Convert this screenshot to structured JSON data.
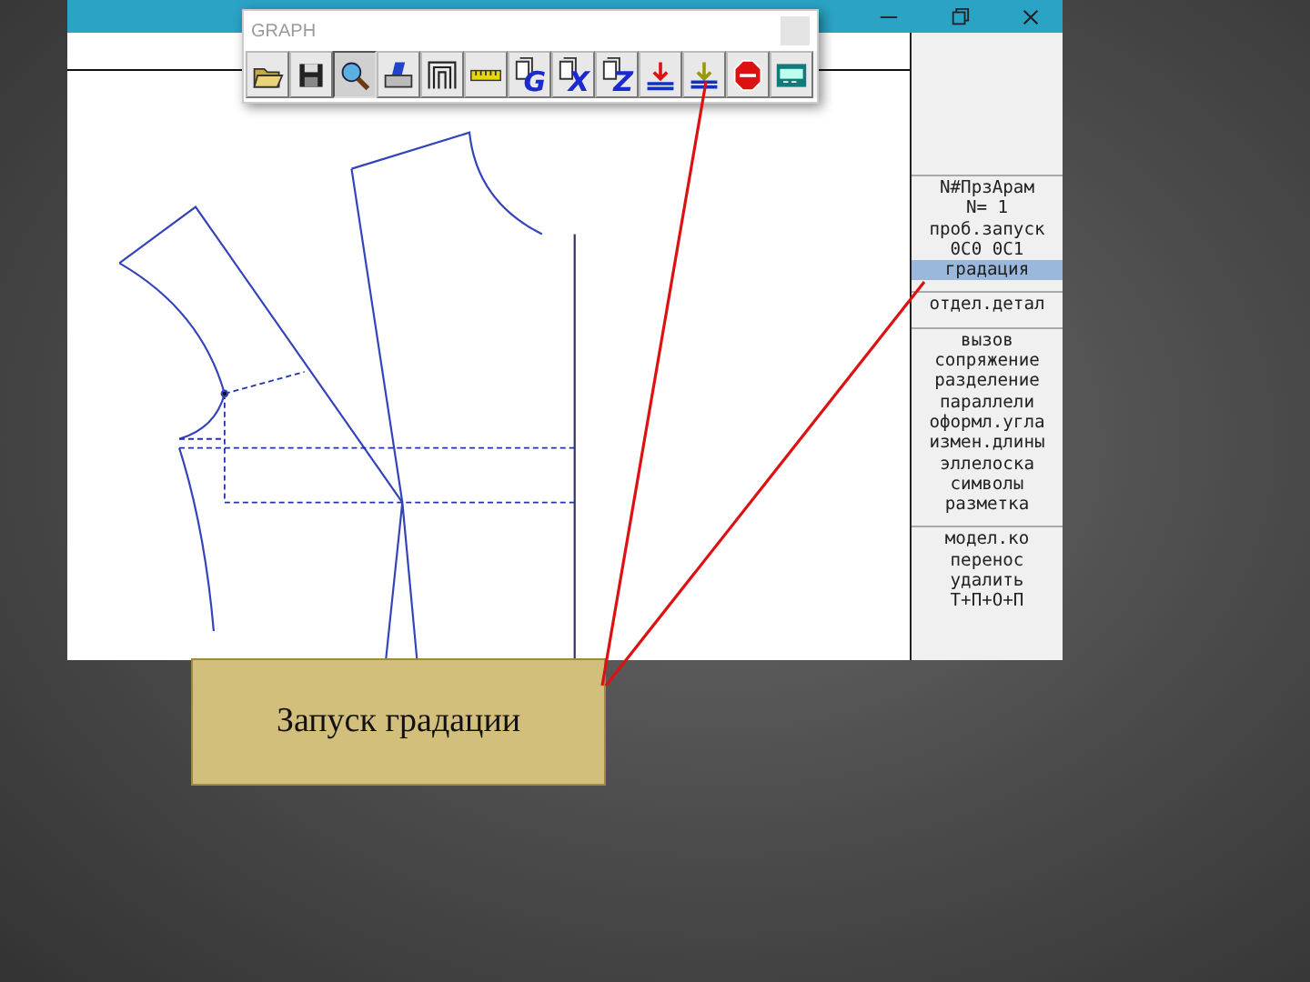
{
  "toolbar": {
    "title": "GRAPH",
    "buttons": [
      {
        "kind": "open",
        "pressed": false
      },
      {
        "kind": "save",
        "pressed": false
      },
      {
        "kind": "zoom",
        "pressed": true
      },
      {
        "kind": "print",
        "pressed": false
      },
      {
        "kind": "frame",
        "pressed": false
      },
      {
        "kind": "ruler",
        "pressed": false
      },
      {
        "kind": "doc",
        "letter": "G",
        "pressed": false
      },
      {
        "kind": "doc",
        "letter": "X",
        "pressed": false
      },
      {
        "kind": "doc",
        "letter": "Z",
        "pressed": false
      },
      {
        "kind": "drop",
        "pressed": false
      },
      {
        "kind": "drop2",
        "pressed": false
      },
      {
        "kind": "stop",
        "pressed": false
      },
      {
        "kind": "screen",
        "pressed": false
      }
    ]
  },
  "menu": {
    "groups": [
      {
        "items": [
          {
            "label": "N#ПрзАрам",
            "selected": false
          },
          {
            "label": "N=  1",
            "selected": false
          },
          {
            "label": "проб.запуск",
            "selected": false
          },
          {
            "label": "0С0 0С1",
            "selected": false
          },
          {
            "label": "градация",
            "selected": true
          }
        ]
      },
      {
        "items": [
          {
            "label": "отдел.детал",
            "selected": false
          }
        ]
      },
      {
        "items": [
          {
            "label": "вызов",
            "selected": false
          },
          {
            "label": "сопряжение",
            "selected": false
          },
          {
            "label": "разделение",
            "selected": false
          },
          {
            "label": "параллели",
            "selected": false
          },
          {
            "label": "оформл.угла",
            "selected": false
          },
          {
            "label": "измен.длины",
            "selected": false
          },
          {
            "label": "эллелоска",
            "selected": false
          },
          {
            "label": "символы",
            "selected": false
          },
          {
            "label": "разметка",
            "selected": false
          }
        ]
      },
      {
        "items": [
          {
            "label": "модел.ко",
            "selected": false
          },
          {
            "label": "перенос",
            "selected": false
          },
          {
            "label": "удалить",
            "selected": false
          },
          {
            "label": "Т+П+О+П",
            "selected": false
          }
        ]
      }
    ]
  },
  "callout": {
    "text": "Запуск градации"
  }
}
